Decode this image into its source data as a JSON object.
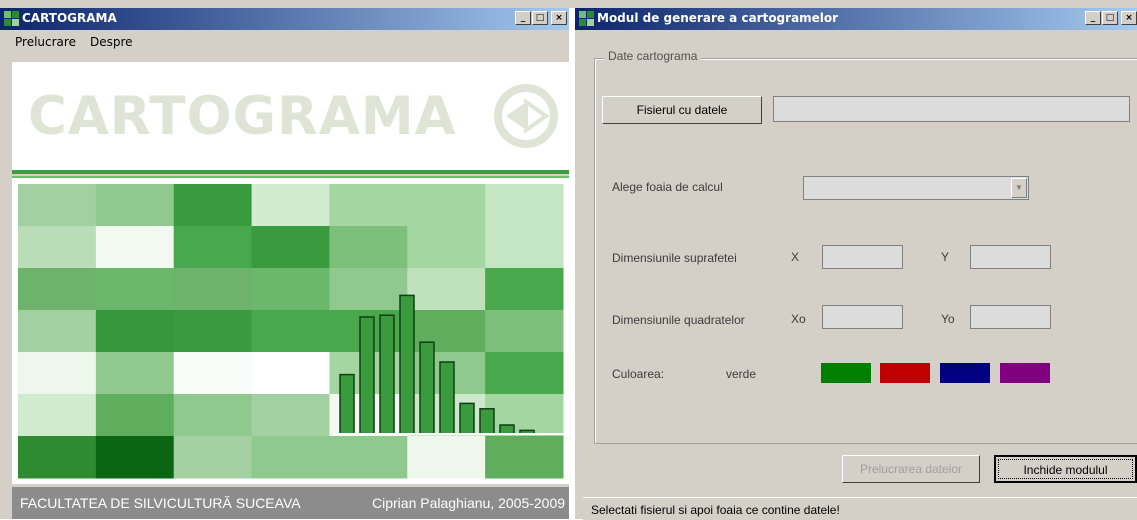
{
  "left_window": {
    "title": "CARTOGRAMA",
    "controls": [
      "_",
      "□",
      "×"
    ],
    "menu": [
      "Prelucrare",
      "Despre"
    ],
    "banner_text": "CARTOGRAMA",
    "footer_left": "FACULTATEA DE SILVICULTURĂ SUCEAVA",
    "footer_right": "Ciprian Palaghianu, 2005-2009"
  },
  "right_window": {
    "title": "Modul de generare a cartogramelor",
    "controls": [
      "_",
      "□",
      "×"
    ],
    "group_label": "Date cartograma",
    "file_button": "Fisierul cu datele",
    "file_path": "",
    "sheet_label": "Alege foaia de calcul",
    "sheet_selected": "",
    "surface_label": "Dimensiunile suprafetei",
    "x_label": "X",
    "y_label": "Y",
    "x_value": "",
    "y_value": "",
    "squares_label": "Dimensiunile quadratelor",
    "xo_label": "Xo",
    "yo_label": "Yo",
    "xo_value": "",
    "yo_value": "",
    "color_label": "Culoarea:",
    "color_value": "verde",
    "swatches": [
      {
        "name": "verde",
        "hex": "#008000"
      },
      {
        "name": "rosu",
        "hex": "#c00000"
      },
      {
        "name": "albastru",
        "hex": "#000080"
      },
      {
        "name": "mov",
        "hex": "#800080"
      }
    ],
    "process_button": "Prelucrarea datelor",
    "close_button": "Inchide modulul",
    "status": "Selectati fisierul si apoi foaia ce contine datele!"
  },
  "colors": {
    "title_start": "#0a246a",
    "title_end": "#a6caf0",
    "face": "#d4d0c8",
    "accent_green": "#3e9b3e",
    "footer": "#8c8c8c"
  },
  "grid_cells": [
    [
      "#a3d0a1",
      "#8fc98e",
      "#3a9a3e",
      "#d0ebcf",
      "#a4d6a2",
      "#a4d6a2",
      "#c4e6c2"
    ],
    [
      "#b9deb7",
      "#f2f9f1",
      "#4aa84c",
      "#3a9a3e",
      "#7cc07b",
      "#a4d6a2",
      "#c4e6c2"
    ],
    [
      "#6db36c",
      "#6bb86a",
      "#6db36c",
      "#6bb86a",
      "#8fc98e",
      "#bfe2bd",
      "#4aa84c"
    ],
    [
      "#a3d0a1",
      "#36983a",
      "#3a9a3e",
      "#4aa84c",
      "#4aa84c",
      "#5fae5d",
      "#7cc07b"
    ],
    [
      "#edf7ec",
      "#8fc98e",
      "#f9fdf9",
      "#ffffff",
      "#a4d6a2",
      "#8fc98e",
      "#4aa84c"
    ],
    [
      "#d0ebcf",
      "#5fae5d",
      "#8fc98e",
      "#a3d0a1",
      "#f2f9f1",
      "#cde9cb",
      "#a4d6a2"
    ],
    [
      "#2e8b31",
      "#0a6612",
      "#a3d0a1",
      "#8fc98e",
      "#8fc98e",
      "#edf7ec",
      "#5fae5d"
    ]
  ],
  "histogram_bars": [
    0.33,
    0.65,
    0.66,
    0.77,
    0.51,
    0.4,
    0.17,
    0.14,
    0.05,
    0.02
  ]
}
